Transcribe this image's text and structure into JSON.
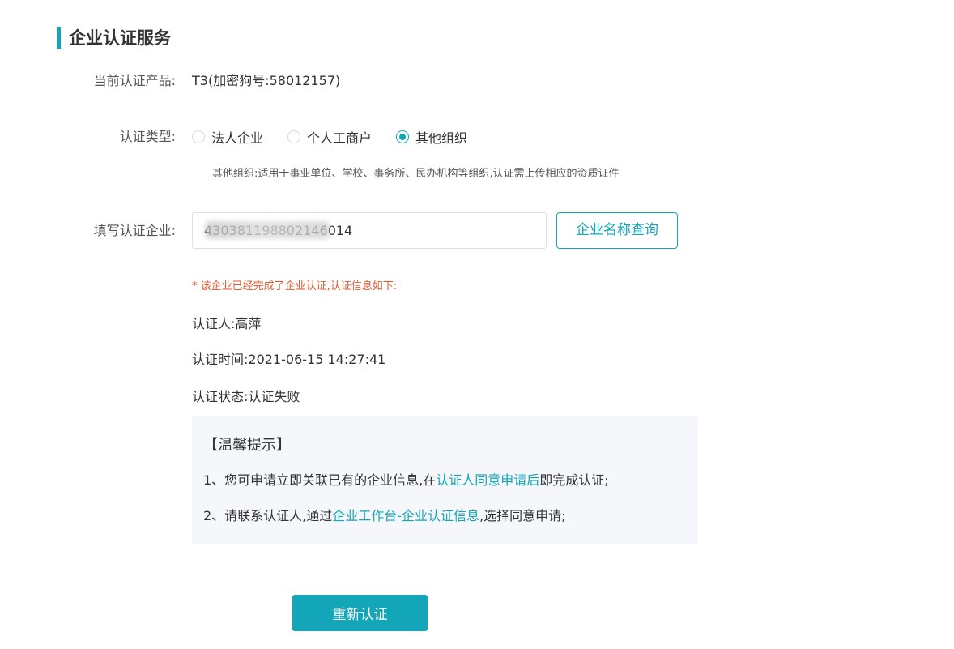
{
  "page": {
    "title": "企业认证服务"
  },
  "product": {
    "label": "当前认证产品:",
    "value": "T3(加密狗号:58012157)"
  },
  "cert_type": {
    "label": "认证类型:",
    "options": [
      {
        "label": "法人企业",
        "checked": false
      },
      {
        "label": "个人工商户",
        "checked": false
      },
      {
        "label": "其他组织",
        "checked": true
      }
    ],
    "hint": "其他组织:适用于事业单位、学校、事务所、民办机构等组织,认证需上传相应的资质证件"
  },
  "company": {
    "label": "填写认证企业:",
    "input_value": "430381198802146014",
    "query_button": "企业名称查询"
  },
  "result": {
    "warning": "* 该企业已经完成了企业认证,认证信息如下:",
    "certifier": "认证人:高萍",
    "cert_time": "认证时间:2021-06-15 14:27:41",
    "cert_status": "认证状态:认证失败"
  },
  "tips": {
    "title": "【温馨提示】",
    "line1_prefix": "1、您可申请立即关联已有的企业信息,在",
    "line1_link": "认证人同意申请后",
    "line1_suffix": "即完成认证;",
    "line2_prefix": "2、请联系认证人,通过",
    "line2_link": "企业工作台-企业认证信息",
    "line2_suffix": ",选择同意申请;"
  },
  "actions": {
    "recert_button": "重新认证"
  },
  "colors": {
    "accent": "#13a6b8",
    "warning": "#e4572e",
    "tips_bg": "#f5f7fa"
  }
}
